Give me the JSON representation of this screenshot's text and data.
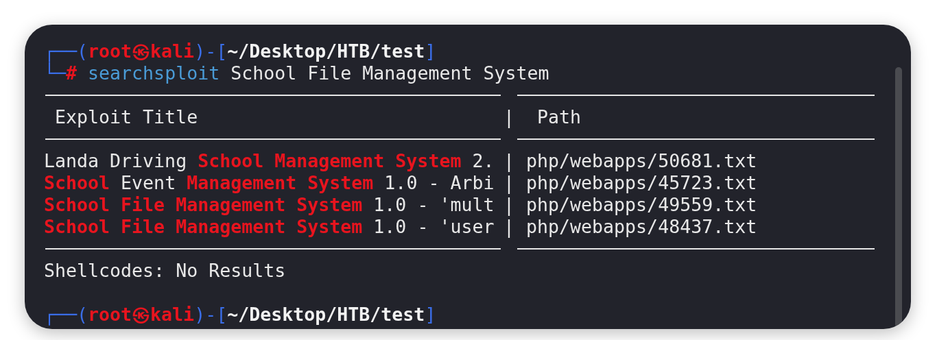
{
  "terminal": {
    "lines": [
      {
        "kind": "prompt_top",
        "segments": [
          {
            "kind": "frame",
            "text": "┌──("
          },
          {
            "kind": "user",
            "text": "root㉿kali"
          },
          {
            "kind": "frame",
            "text": ")-["
          },
          {
            "kind": "path",
            "text": "~/Desktop/HTB/test"
          },
          {
            "kind": "frame",
            "text": "]"
          }
        ]
      },
      {
        "kind": "prompt_bottom",
        "segments": [
          {
            "kind": "frame",
            "text": "└─"
          },
          {
            "kind": "prompt_char",
            "text": "#"
          },
          {
            "kind": "command",
            "text": " searchsploit"
          },
          {
            "kind": "text",
            "text": " School File Management System"
          }
        ]
      },
      {
        "kind": "rule"
      },
      {
        "kind": "table_header",
        "columns": [
          "Exploit Title",
          "Path"
        ],
        "separator": "|"
      },
      {
        "kind": "rule"
      },
      {
        "kind": "table_row",
        "title": [
          {
            "kind": "text",
            "text": "Landa Driving "
          },
          {
            "kind": "match",
            "text": "School Management System"
          },
          {
            "kind": "text",
            "text": " 2."
          }
        ],
        "separator": "|",
        "path": "php/webapps/50681.txt"
      },
      {
        "kind": "table_row",
        "title": [
          {
            "kind": "match",
            "text": "School"
          },
          {
            "kind": "text",
            "text": " Event "
          },
          {
            "kind": "match",
            "text": "Management System"
          },
          {
            "kind": "text",
            "text": " 1.0 - Arbi"
          }
        ],
        "separator": "|",
        "path": "php/webapps/45723.txt"
      },
      {
        "kind": "table_row",
        "title": [
          {
            "kind": "match",
            "text": "School File Management System"
          },
          {
            "kind": "text",
            "text": " 1.0 - 'mult"
          }
        ],
        "separator": "|",
        "path": "php/webapps/49559.txt"
      },
      {
        "kind": "table_row",
        "title": [
          {
            "kind": "match",
            "text": "School File Management System"
          },
          {
            "kind": "text",
            "text": " 1.0 - 'user"
          }
        ],
        "separator": "|",
        "path": "php/webapps/48437.txt"
      },
      {
        "kind": "rule"
      },
      {
        "kind": "output",
        "segments": [
          {
            "kind": "text",
            "text": "Shellcodes: No Results"
          }
        ]
      },
      {
        "kind": "blank"
      },
      {
        "kind": "prompt_top",
        "segments": [
          {
            "kind": "frame",
            "text": "┌──("
          },
          {
            "kind": "user",
            "text": "root㉿kali"
          },
          {
            "kind": "frame",
            "text": ")-["
          },
          {
            "kind": "path",
            "text": "~/Desktop/HTB/test"
          },
          {
            "kind": "frame",
            "text": "]"
          }
        ]
      }
    ]
  }
}
